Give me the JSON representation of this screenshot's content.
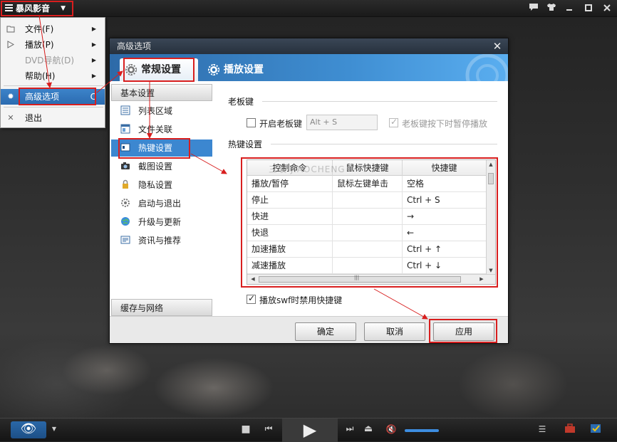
{
  "app": {
    "logo_label": "暴风影音",
    "menu_arrow": "▼",
    "window_buttons": [
      "chat-icon",
      "skin-icon",
      "minimize-icon",
      "maximize-icon",
      "close-icon"
    ]
  },
  "main_menu": {
    "items": [
      {
        "label": "文件(F)",
        "icon": "folder-icon",
        "has_submenu": true,
        "disabled": false
      },
      {
        "label": "播放(P)",
        "icon": "play-icon",
        "has_submenu": true,
        "disabled": false
      },
      {
        "label": "DVD导航(D)",
        "icon": "",
        "has_submenu": true,
        "disabled": true
      },
      {
        "label": "帮助(H)",
        "icon": "",
        "has_submenu": true,
        "disabled": false
      },
      {
        "label": "高级选项",
        "icon": "gear-icon",
        "shortcut": "C",
        "active": true
      },
      {
        "label": "退出",
        "icon": "exit-icon"
      }
    ]
  },
  "dialog": {
    "title": "高级选项",
    "close": "✕",
    "tabs": [
      {
        "label": "常规设置",
        "active": true
      },
      {
        "label": "播放设置",
        "active": false
      }
    ],
    "sidebar": {
      "group_basic": "基本设置",
      "items": [
        {
          "label": "列表区域",
          "icon": "list-icon"
        },
        {
          "label": "文件关联",
          "icon": "file-assoc-icon"
        },
        {
          "label": "热键设置",
          "icon": "hotkey-icon",
          "active": true
        },
        {
          "label": "截图设置",
          "icon": "camera-icon"
        },
        {
          "label": "隐私设置",
          "icon": "lock-icon"
        },
        {
          "label": "启动与退出",
          "icon": "startup-gear-icon"
        },
        {
          "label": "升级与更新",
          "icon": "globe-icon"
        },
        {
          "label": "资讯与推荐",
          "icon": "news-icon"
        }
      ],
      "group_cache": "缓存与网络"
    },
    "boss_key": {
      "section_title": "老板键",
      "enable_label": "开启老板键",
      "enable_checked": false,
      "key_value": "Alt + S",
      "pause_label": "老板键按下时暂停播放",
      "pause_checked": true
    },
    "hotkeys": {
      "section_title": "热键设置",
      "watermark": "三联 JIAOCHENG",
      "columns": [
        "控制命令",
        "鼠标快捷键",
        "快捷键"
      ],
      "rows": [
        [
          "播放/暂停",
          "鼠标左键单击",
          "空格"
        ],
        [
          "停止",
          "",
          "Ctrl + S"
        ],
        [
          "快进",
          "",
          "→"
        ],
        [
          "快退",
          "",
          "←"
        ],
        [
          "加速播放",
          "",
          "Ctrl + ↑"
        ],
        [
          "减速播放",
          "",
          "Ctrl + ↓"
        ]
      ],
      "swf_label": "播放swf时禁用快捷键",
      "swf_checked": true
    },
    "buttons": {
      "ok": "确定",
      "cancel": "取消",
      "apply": "应用"
    }
  },
  "controls": {
    "eye": "👁",
    "stop": "■",
    "prev": "⏮",
    "play": "▶",
    "next": "⏭",
    "eject": "⏏",
    "mute": "🔇",
    "volume_fraction": 0.75
  },
  "colors": {
    "annotation_red": "#d81e1e",
    "accent_blue": "#3c87d0"
  }
}
